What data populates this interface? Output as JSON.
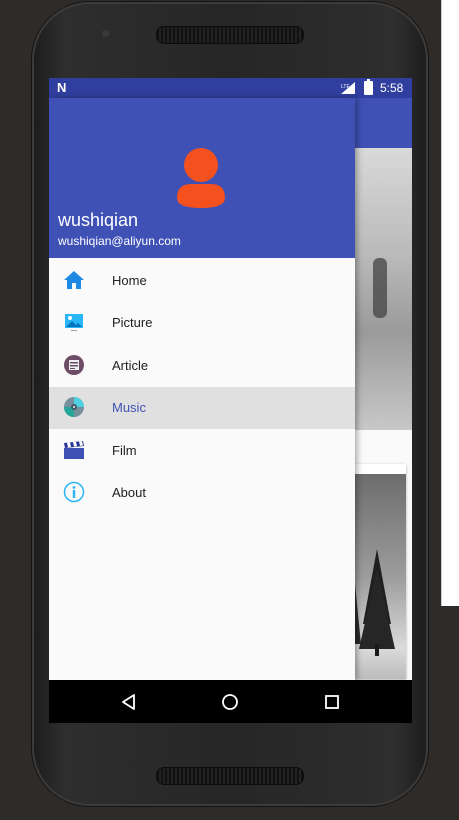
{
  "status_bar": {
    "time": "5:58",
    "network": "LTE"
  },
  "drawer": {
    "header": {
      "user_name": "wushiqian",
      "user_email": "wushiqian@aliyun.com"
    },
    "items": [
      {
        "label": "Home",
        "icon": "home-icon",
        "active": false
      },
      {
        "label": "Picture",
        "icon": "picture-icon",
        "active": false
      },
      {
        "label": "Article",
        "icon": "article-icon",
        "active": false
      },
      {
        "label": "Music",
        "icon": "music-disc-icon",
        "active": true
      },
      {
        "label": "Film",
        "icon": "film-clapper-icon",
        "active": false
      },
      {
        "label": "About",
        "icon": "info-icon",
        "active": false
      }
    ]
  },
  "navigation_bar": {
    "buttons": [
      "back-icon",
      "home-circle-icon",
      "recents-icon"
    ]
  },
  "colors": {
    "primary": "#3f51b5",
    "primary_dark": "#303f9f",
    "avatar": "#f4511e",
    "active_text": "#3f51b5"
  }
}
